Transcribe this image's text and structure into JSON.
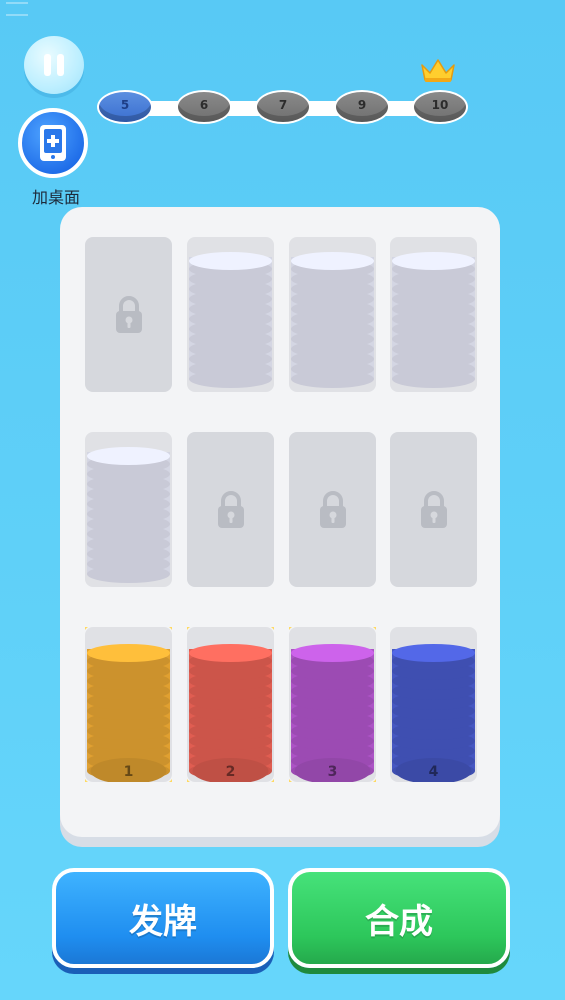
{
  "levels": [
    {
      "label": "5",
      "state": "current"
    },
    {
      "label": "6",
      "state": "locked"
    },
    {
      "label": "7",
      "state": "locked"
    },
    {
      "label": "9",
      "state": "locked"
    },
    {
      "label": "10",
      "state": "locked"
    }
  ],
  "desktop": {
    "label": "加桌面",
    "icon": "phone-plus-icon"
  },
  "pause": {
    "icon": "pause-icon"
  },
  "crown": {
    "icon": "crown-icon",
    "color": "#ffce2e"
  },
  "slots_row1": [
    {
      "state": "locked"
    },
    {
      "state": "stack",
      "color": "#e4e6f4"
    },
    {
      "state": "stack",
      "color": "#e4e6f4"
    },
    {
      "state": "stack",
      "color": "#e4e6f4"
    }
  ],
  "slots_row2": [
    {
      "state": "stack",
      "color": "#e4e6f4"
    },
    {
      "state": "locked"
    },
    {
      "state": "locked"
    },
    {
      "state": "locked"
    }
  ],
  "slots_row3": [
    {
      "state": "stack",
      "color": "#ffb638",
      "label": "1",
      "glow": true
    },
    {
      "state": "stack",
      "color": "#ff6a5c",
      "label": "2",
      "glow": true
    },
    {
      "state": "stack",
      "color": "#c35ee0",
      "label": "3",
      "glow": true
    },
    {
      "state": "stack",
      "color": "#4f63dd",
      "label": "4",
      "glow": false
    }
  ],
  "buttons": {
    "deal": "发牌",
    "merge": "合成"
  }
}
